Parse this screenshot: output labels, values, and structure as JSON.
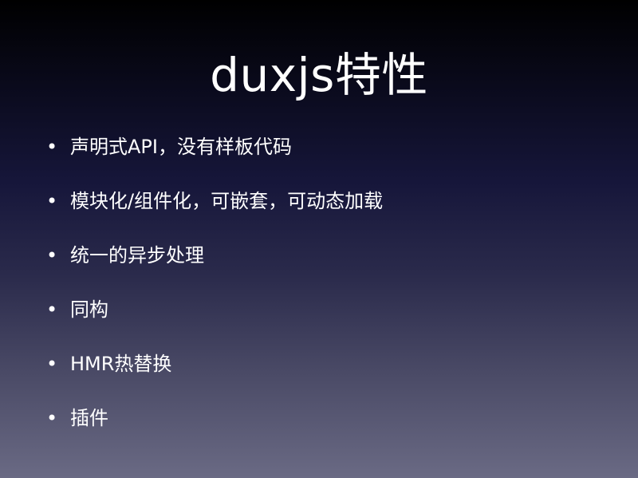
{
  "slide": {
    "title": "duxjs特性",
    "bullet_glyph": "•",
    "bullets": [
      "声明式API，没有样板代码",
      "模块化/组件化，可嵌套，可动态加载",
      "统一的异步处理",
      "同构",
      "HMR热替换",
      "插件"
    ]
  }
}
